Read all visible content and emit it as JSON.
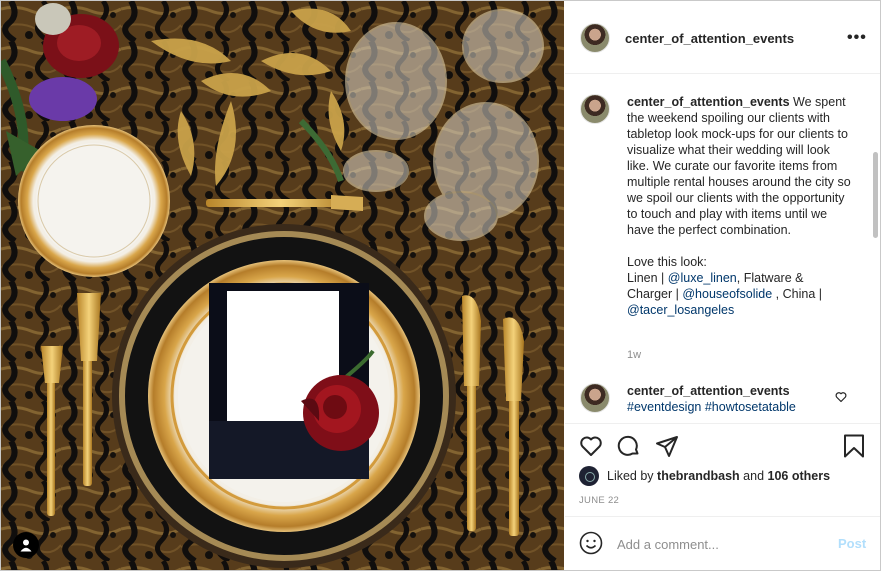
{
  "post": {
    "username": "center_of_attention_events",
    "more_icon": "more-horizontal-icon"
  },
  "caption": {
    "username": "center_of_attention_events",
    "text": "We spent the weekend spoiling our clients with tabletop look mock-ups for our clients to visualize what their wedding will look like. We curate our favorite items from multiple rental houses around the city so we spoil our clients with the opportunity to touch and play with items until we have the perfect combination.",
    "love_line": "Love this look:",
    "linen_label": "Linen | ",
    "linen_mention": "@luxe_linen",
    "flatware_label": ", Flatware & Charger | ",
    "flatware_mention": "@houseofsolide",
    "china_label": " , China | ",
    "china_mention": "@tacer_losangeles",
    "timestamp": "1w"
  },
  "comment2": {
    "username": "center_of_attention_events",
    "tags": "#eventdesign #howtosetatable"
  },
  "likes": {
    "prefix": "Liked by ",
    "user": "thebrandbash",
    "middle": " and ",
    "others": "106 others"
  },
  "date": "JUNE 22",
  "add_comment": {
    "placeholder": "Add a comment...",
    "post_label": "Post"
  },
  "colors": {
    "link": "#00376b",
    "post_disabled": "#b2dffc",
    "secondary_text": "#8e8e8e"
  }
}
